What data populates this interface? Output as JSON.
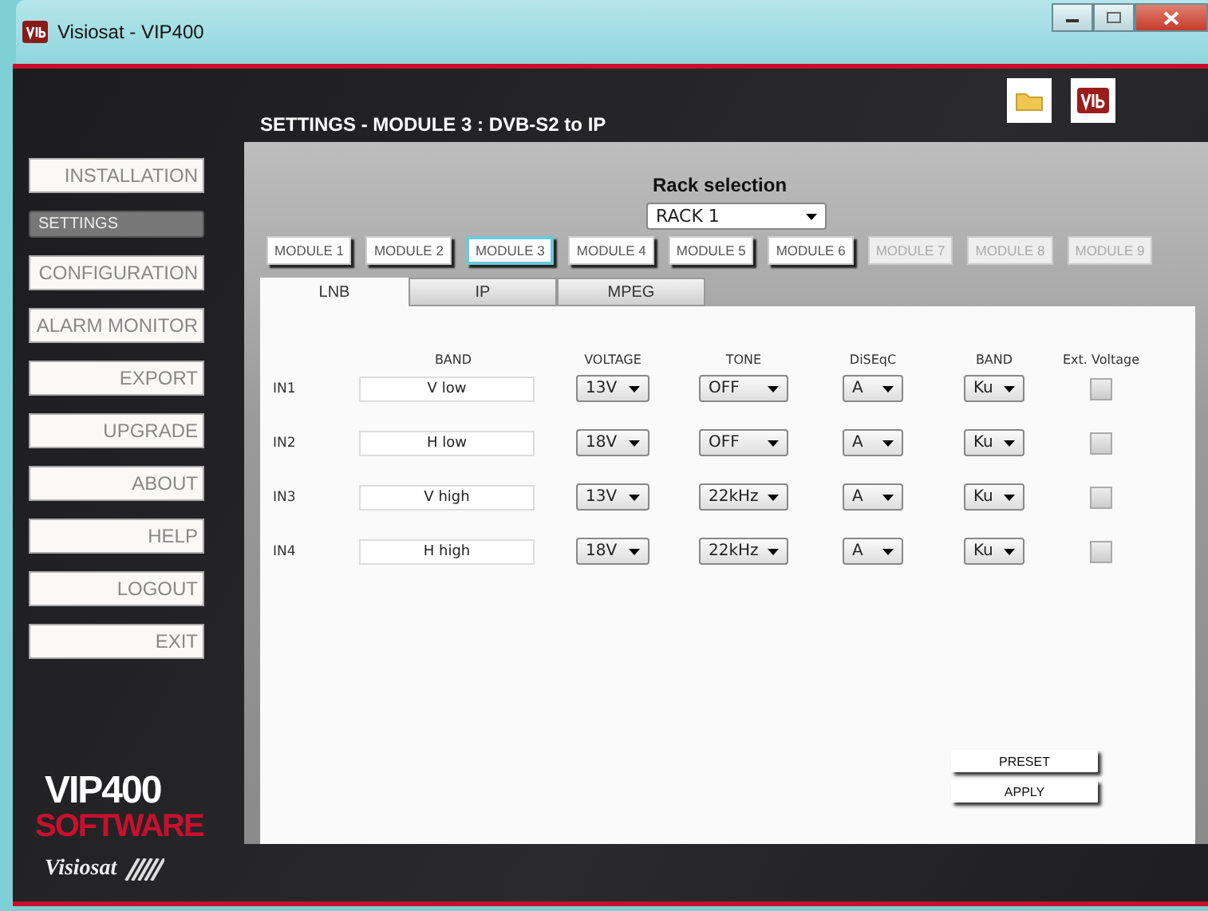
{
  "window": {
    "title": "Visiosat - VIP400"
  },
  "header": {
    "title": "SETTINGS - MODULE 3 : DVB-S2 to IP"
  },
  "sidebar": {
    "items": [
      {
        "label": "INSTALLATION",
        "selected": false
      },
      {
        "label": "SETTINGS",
        "selected": true
      },
      {
        "label": "CONFIGURATION",
        "selected": false
      },
      {
        "label": "ALARM MONITOR",
        "selected": false
      },
      {
        "label": "EXPORT",
        "selected": false
      },
      {
        "label": "UPGRADE",
        "selected": false
      },
      {
        "label": "ABOUT",
        "selected": false
      },
      {
        "label": "HELP",
        "selected": false
      },
      {
        "label": "LOGOUT",
        "selected": false
      },
      {
        "label": "EXIT",
        "selected": false
      }
    ]
  },
  "logo": {
    "line1": "VIP400",
    "line2": "SOFTWARE",
    "brand": "Visiosat"
  },
  "rack": {
    "label": "Rack selection",
    "value": "RACK 1"
  },
  "modules": [
    {
      "label": "MODULE 1",
      "selected": false,
      "disabled": false
    },
    {
      "label": "MODULE 2",
      "selected": false,
      "disabled": false
    },
    {
      "label": "MODULE 3",
      "selected": true,
      "disabled": false
    },
    {
      "label": "MODULE 4",
      "selected": false,
      "disabled": false
    },
    {
      "label": "MODULE 5",
      "selected": false,
      "disabled": false
    },
    {
      "label": "MODULE 6",
      "selected": false,
      "disabled": false
    },
    {
      "label": "MODULE 7",
      "selected": false,
      "disabled": true
    },
    {
      "label": "MODULE 8",
      "selected": false,
      "disabled": true
    },
    {
      "label": "MODULE 9",
      "selected": false,
      "disabled": true
    }
  ],
  "tabs": [
    {
      "label": "LNB",
      "selected": true
    },
    {
      "label": "IP",
      "selected": false
    },
    {
      "label": "MPEG",
      "selected": false
    }
  ],
  "table": {
    "columns": [
      "BAND",
      "VOLTAGE",
      "TONE",
      "DiSEqC",
      "BAND",
      "Ext. Voltage"
    ],
    "rows": [
      {
        "input": "IN1",
        "band": "V low",
        "voltage": "13V",
        "tone": "OFF",
        "diseqc": "A",
        "lnb_band": "Ku",
        "ext_voltage": false
      },
      {
        "input": "IN2",
        "band": "H low",
        "voltage": "18V",
        "tone": "OFF",
        "diseqc": "A",
        "lnb_band": "Ku",
        "ext_voltage": false
      },
      {
        "input": "IN3",
        "band": "V high",
        "voltage": "13V",
        "tone": "22kHz",
        "diseqc": "A",
        "lnb_band": "Ku",
        "ext_voltage": false
      },
      {
        "input": "IN4",
        "band": "H high",
        "voltage": "18V",
        "tone": "22kHz",
        "diseqc": "A",
        "lnb_band": "Ku",
        "ext_voltage": false
      }
    ]
  },
  "buttons": [
    "PRESET",
    "APPLY"
  ]
}
